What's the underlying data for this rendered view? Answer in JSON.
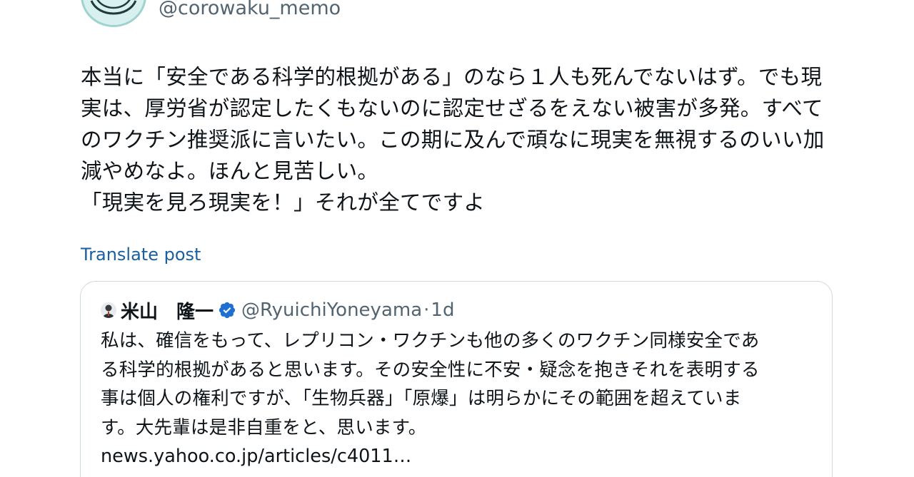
{
  "post": {
    "handle": "@corowaku_memo",
    "body_lines": [
      "本当に「安全である科学的根拠がある」のなら１人も死んでないはず。でも現",
      "実は、厚労省が認定したくもないのに認定せざるをえない被害が多発。すべて",
      "のワクチン推奨派に言いたい。この期に及んで頑なに現実を無視するのいい加",
      "減やめなよ。ほんと見苦しい。",
      "「現実を見ろ現実を！」それが全てですよ"
    ],
    "translate_label": "Translate post"
  },
  "quote": {
    "name": "米山　隆一",
    "handle": "@RyuichiYoneyama",
    "separator": "·",
    "time": "1d",
    "body_lines": [
      "私は、確信をもって、レプリコン・ワクチンも他の多くのワクチン同様安全であ",
      "る科学的根拠があると思います。その安全性に不安・疑念を抱きそれを表明する",
      "事は個人の権利ですが、「生物兵器」「原爆」は明らかにその範囲を超えていま",
      "す。大先輩は是非自重をと、思います。"
    ],
    "link": "news.yahoo.co.jp/articles/c4011…"
  },
  "icons": {
    "avatar": "user-avatar",
    "quote_avatar": "quoted-user-avatar",
    "verified": "verified-badge-icon"
  },
  "colors": {
    "text": "#0f1419",
    "secondary": "#536471",
    "link": "#1a5f9f",
    "verified": "#1d6fd1",
    "border": "#cfd9de"
  }
}
